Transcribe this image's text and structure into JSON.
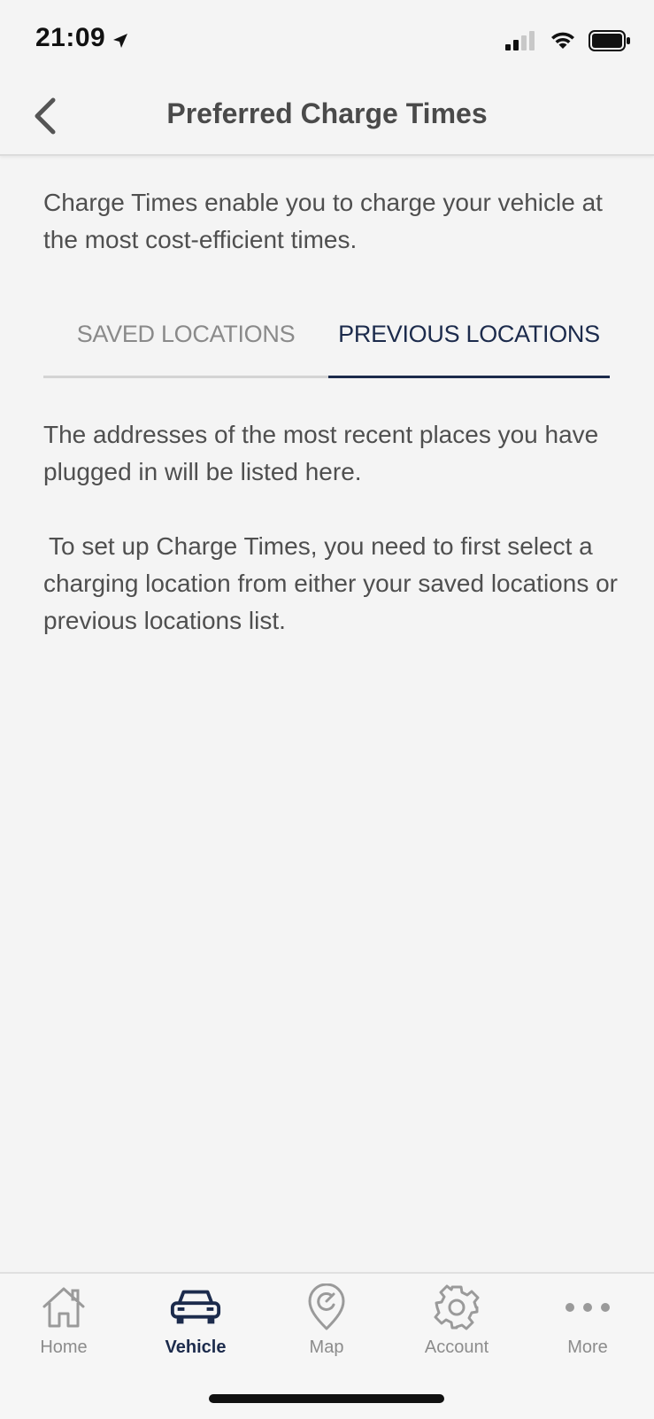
{
  "status_bar": {
    "time": "21:09"
  },
  "nav": {
    "title": "Preferred Charge Times",
    "back_icon": "chevron-left-icon"
  },
  "intro": {
    "text": "Charge Times enable you to charge your vehicle at the most cost-efficient times."
  },
  "tabs": [
    {
      "label": "SAVED LOCATIONS",
      "active": false
    },
    {
      "label": "PREVIOUS LOCATIONS",
      "active": true
    }
  ],
  "content": {
    "paragraph_1": "The addresses of the most recent places you have plugged in will be listed here.",
    "paragraph_2": "To set up Charge Times, you need to first select a charging location from either your saved locations or previous locations list."
  },
  "tab_bar": {
    "items": [
      {
        "label": "Home",
        "icon": "home-icon",
        "active": false
      },
      {
        "label": "Vehicle",
        "icon": "vehicle-icon",
        "active": true
      },
      {
        "label": "Map",
        "icon": "map-pin-icon",
        "active": false
      },
      {
        "label": "Account",
        "icon": "gear-icon",
        "active": false
      },
      {
        "label": "More",
        "icon": "more-dots-icon",
        "active": false
      }
    ]
  },
  "colors": {
    "accent": "#1c2b4c",
    "inactive": "#8c8c8c",
    "background": "#f4f4f4"
  }
}
